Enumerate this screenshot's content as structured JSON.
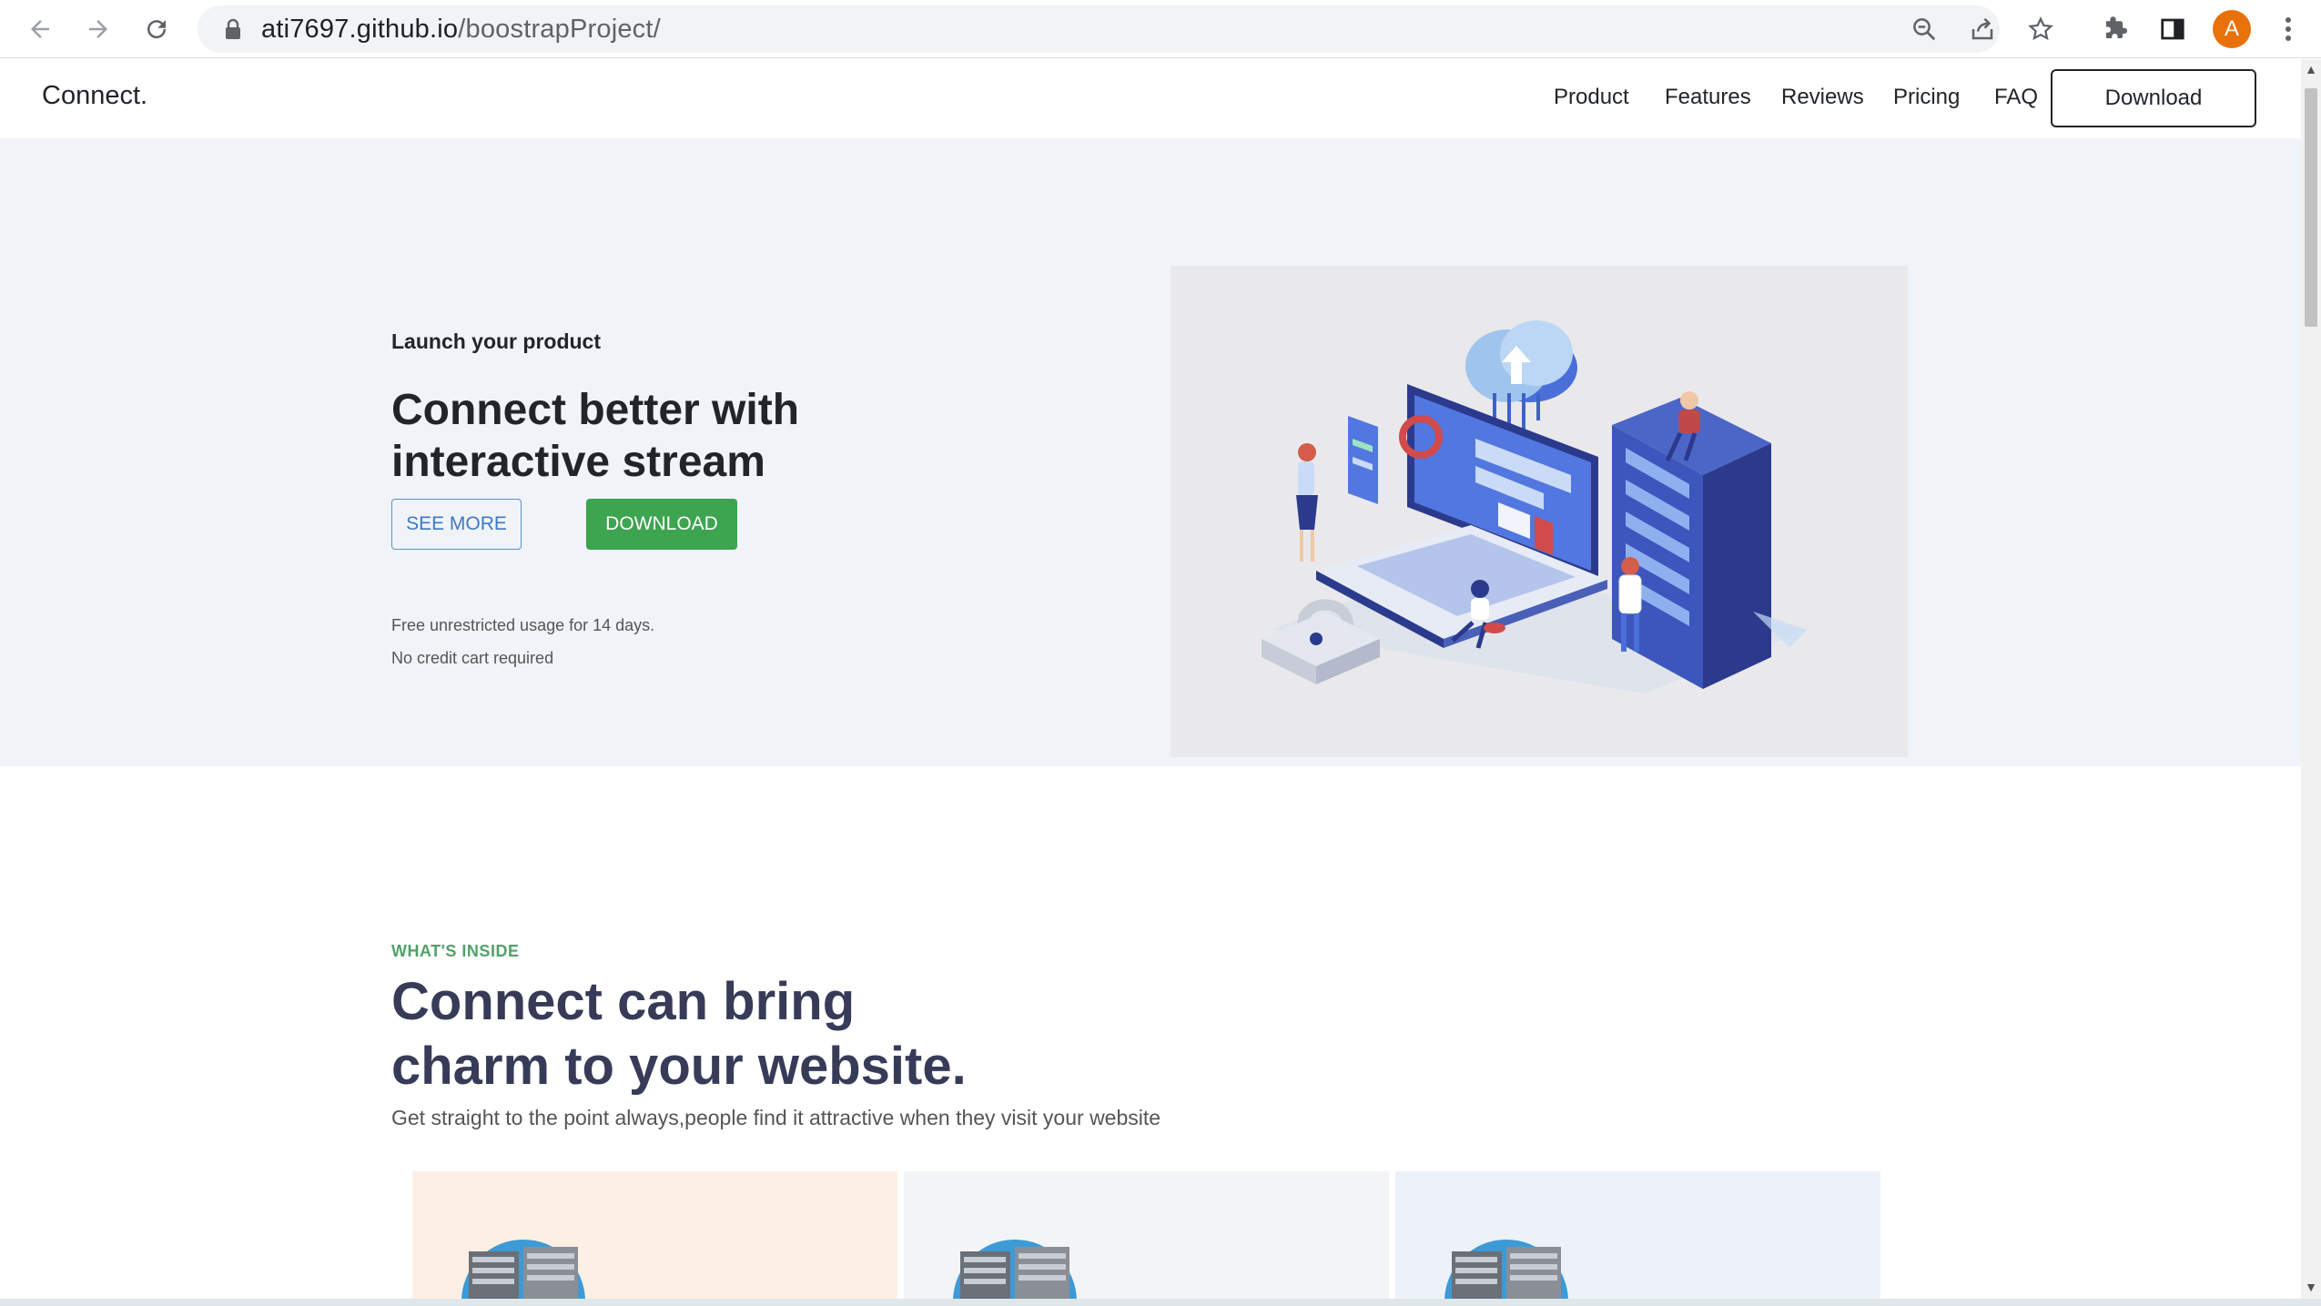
{
  "browser": {
    "url_host": "ati7697.github.io",
    "url_path": "/boostrapProject/",
    "profile_initial": "A",
    "icons": [
      "back-icon",
      "forward-icon",
      "reload-icon",
      "lock-icon",
      "zoom-icon",
      "share-icon",
      "star-icon",
      "extensions-icon",
      "side-panel-icon",
      "menu-icon"
    ]
  },
  "navbar": {
    "brand": "Connect.",
    "links": [
      "Product",
      "Features",
      "Reviews",
      "Pricing",
      "FAQ"
    ],
    "download_label": "Download"
  },
  "hero": {
    "eyebrow": "Launch your product",
    "title": "Connect better with interactive stream",
    "see_more_label": "SEE MORE",
    "download_label": "DOWNLOAD",
    "note1": "Free unrestricted usage for 14 days.",
    "note2": "No credit cart required"
  },
  "features": {
    "eyebrow": "WHAT'S INSIDE",
    "title_line1": "Connect can bring",
    "title_line2": "charm to your website.",
    "subtitle": "Get straight to the point always,people find it attractive when they visit your website",
    "card_colors": [
      "#fcefe4",
      "#f3f4f6",
      "#edf2f9"
    ]
  },
  "colors": {
    "hero_bg": "#f0f3f7",
    "green": "#3da44f",
    "blue_outline": "#3d78c9",
    "eyebrow_green": "#52a16a",
    "heading_navy": "#383b58"
  }
}
